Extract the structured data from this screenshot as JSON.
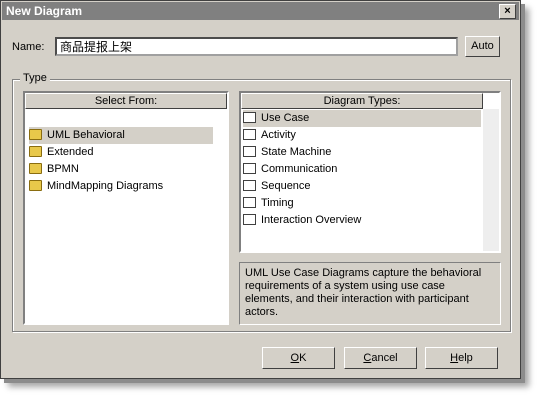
{
  "window": {
    "title": "New Diagram",
    "close_glyph": "×"
  },
  "name": {
    "label": "Name:",
    "value": "商品提报上架"
  },
  "auto_label": "Auto",
  "type_group_label": "Type",
  "select_from": {
    "header": "Select From:",
    "items": [
      {
        "label": "UML Behavioral",
        "icon": "folder-icon",
        "selected": true
      },
      {
        "label": "Extended",
        "icon": "folder-icon"
      },
      {
        "label": "BPMN",
        "icon": "folder-icon"
      },
      {
        "label": "MindMapping Diagrams",
        "icon": "folder-icon"
      }
    ]
  },
  "diagram_types": {
    "header": "Diagram Types:",
    "items": [
      {
        "label": "Use Case",
        "icon": "use-case-icon",
        "selected": true
      },
      {
        "label": "Activity",
        "icon": "activity-icon"
      },
      {
        "label": "State Machine",
        "icon": "state-machine-icon"
      },
      {
        "label": "Communication",
        "icon": "communication-icon"
      },
      {
        "label": "Sequence",
        "icon": "sequence-icon"
      },
      {
        "label": "Timing",
        "icon": "timing-icon"
      },
      {
        "label": "Interaction Overview",
        "icon": "interaction-overview-icon"
      }
    ]
  },
  "description": "UML Use Case Diagrams capture the behavioral requirements of a system using use case elements, and their interaction with participant actors.",
  "buttons": {
    "ok": {
      "mnemonic": "O",
      "rest": "K"
    },
    "cancel": {
      "mnemonic": "C",
      "rest": "ancel"
    },
    "help": {
      "mnemonic": "H",
      "rest": "elp"
    }
  }
}
